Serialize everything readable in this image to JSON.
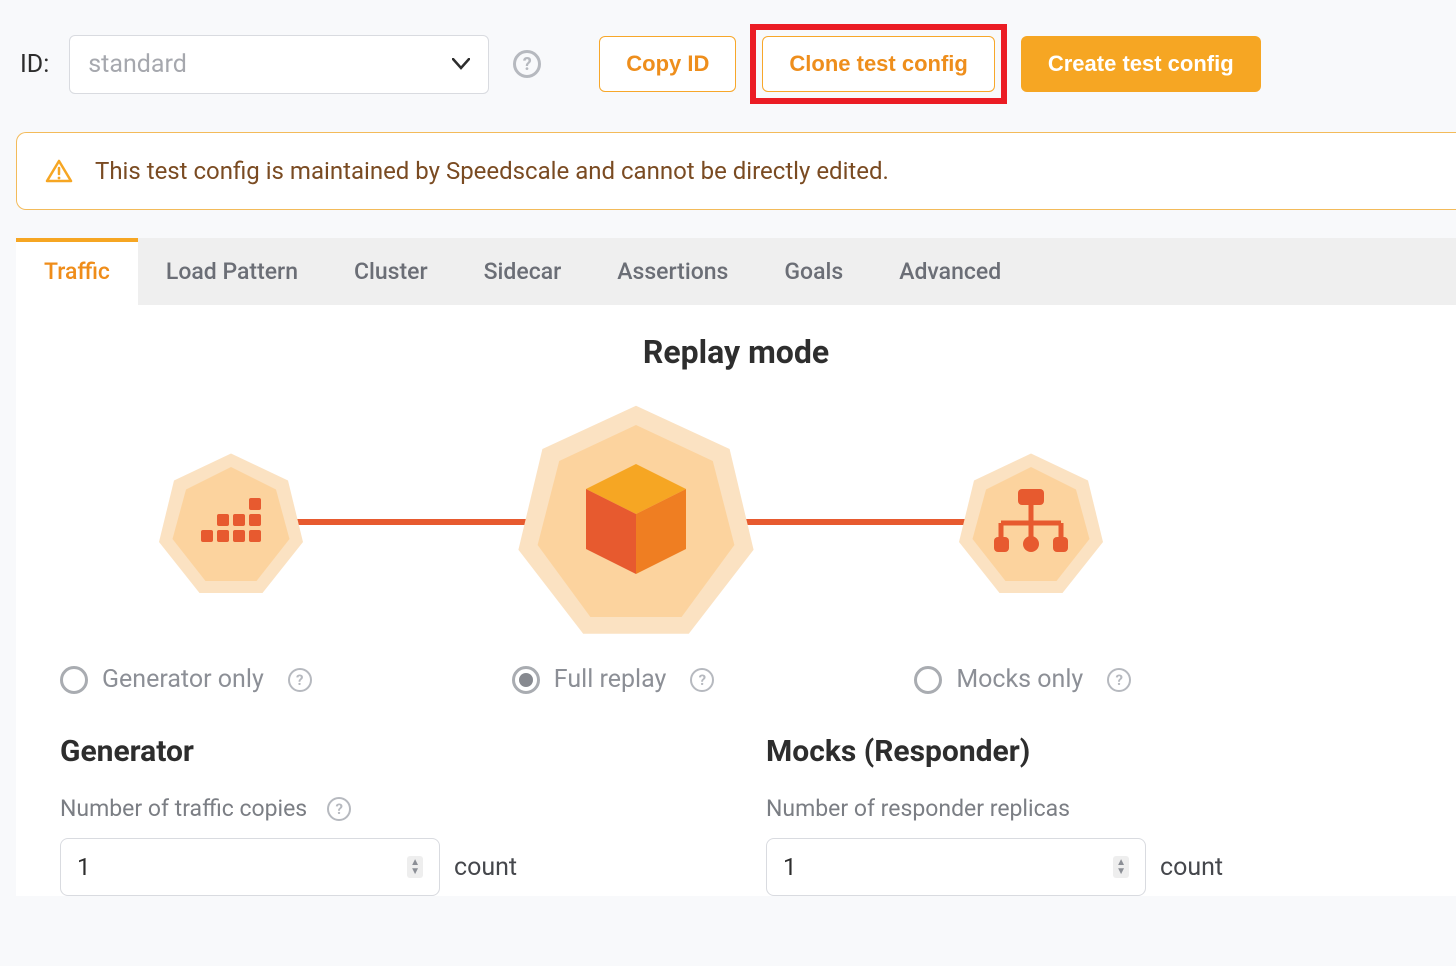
{
  "toolbar": {
    "id_label": "ID:",
    "id_value": "standard",
    "copy_id": "Copy ID",
    "clone": "Clone test config",
    "create": "Create test config"
  },
  "alert": {
    "text": "This test config is maintained by Speedscale and cannot be directly edited."
  },
  "tabs": [
    "Traffic",
    "Load Pattern",
    "Cluster",
    "Sidecar",
    "Assertions",
    "Goals",
    "Advanced"
  ],
  "active_tab": 0,
  "replay": {
    "title": "Replay mode",
    "options": [
      {
        "label": "Generator only"
      },
      {
        "label": "Full replay"
      },
      {
        "label": "Mocks only"
      }
    ],
    "selected": 1
  },
  "generator": {
    "heading": "Generator",
    "field_label": "Number of traffic copies",
    "value": "1",
    "unit": "count"
  },
  "mocks": {
    "heading": "Mocks (Responder)",
    "field_label": "Number of responder replicas",
    "value": "1",
    "unit": "count"
  }
}
